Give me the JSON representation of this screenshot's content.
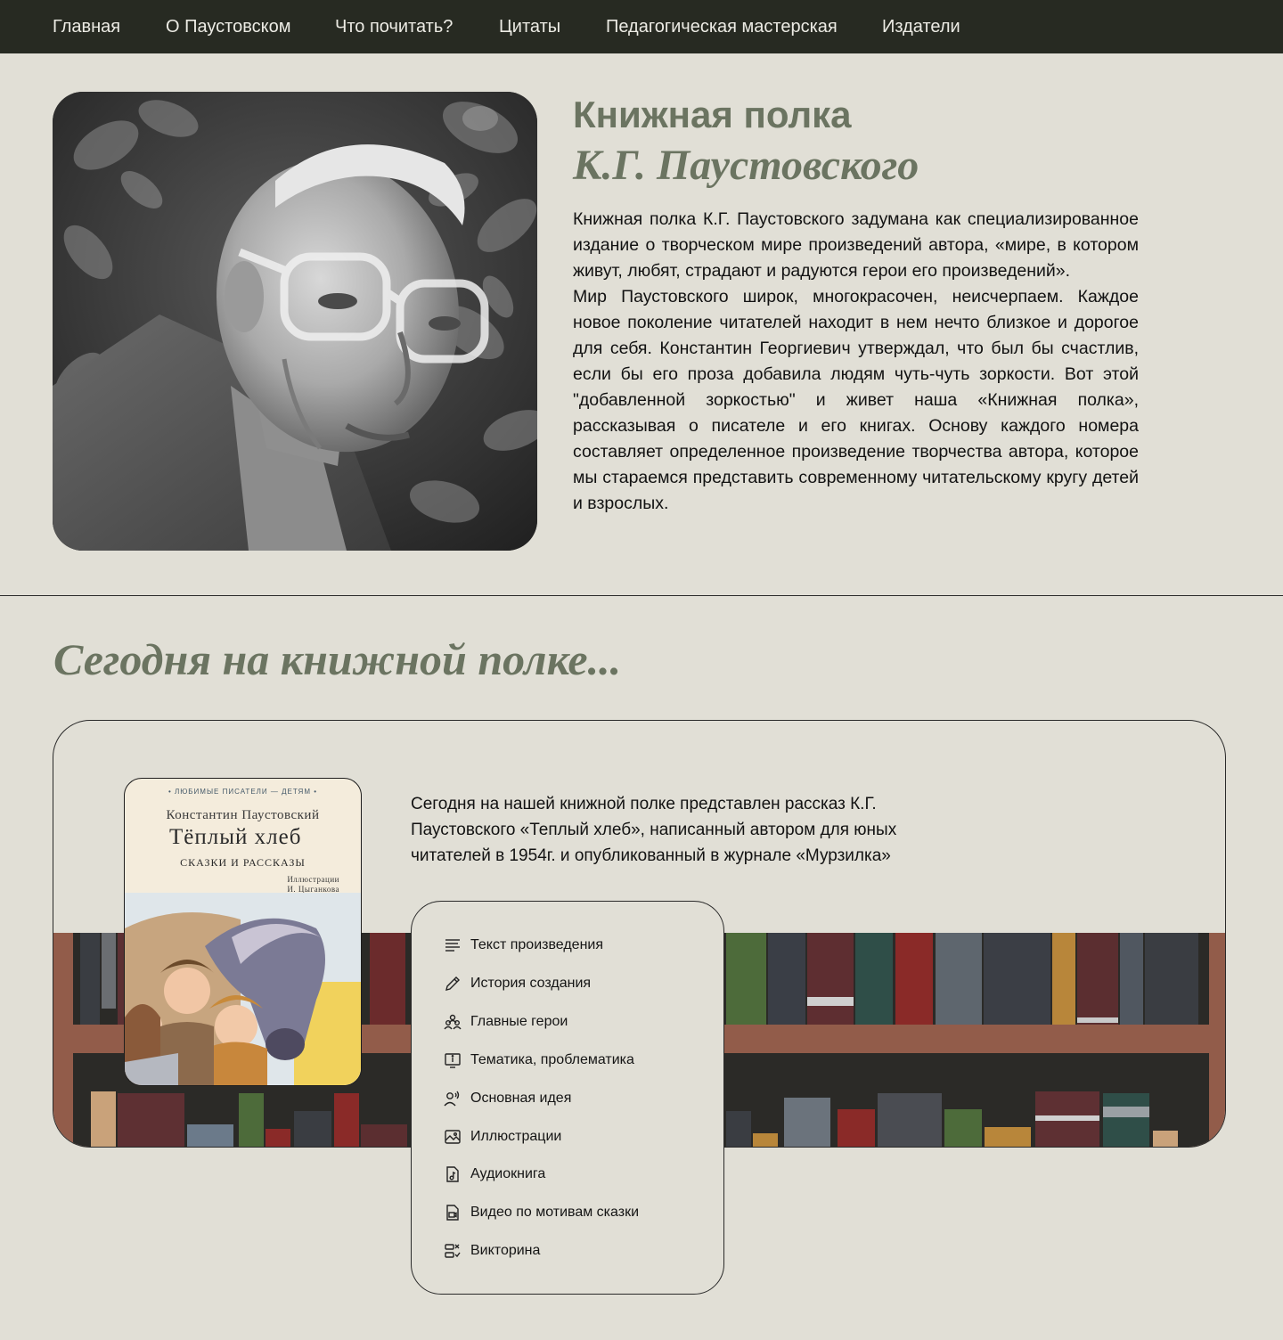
{
  "nav": {
    "items": [
      {
        "label": "Главная"
      },
      {
        "label": "О Паустовском"
      },
      {
        "label": "Что почитать?"
      },
      {
        "label": "Цитаты"
      },
      {
        "label": "Педагогическая мастерская"
      },
      {
        "label": "Издатели"
      }
    ]
  },
  "hero": {
    "title_line1": "Книжная полка",
    "title_line2": "К.Г. Паустовского",
    "paragraph1": "Книжная полка К.Г. Паустовского задумана как специализированное издание о творческом мире произведений автора, «мире, в котором живут, любят, страдают и радуются герои его произведений».",
    "paragraph2": "Мир Паустовского широк, многокрасочен, неисчерпаем. Каждое новое поколение читателей находит в нем нечто близкое и дорогое для себя. Константин Георгиевич утверждал, что был бы счастлив, если бы его проза добавила людям чуть-чуть зоркости. Вот этой \"добавленной зоркостью\" и живет наша «Книжная полка», рассказывая о писателе и его книгах. Основу каждого номера составляет определенное произведение творчества автора, которое мы стараемся представить современному читательскому кругу детей и взрослых."
  },
  "today": {
    "section_title": "Сегодня на книжной полке...",
    "description": "Сегодня на нашей книжной полке представлен рассказ К.Г. Паустовского «Теплый хлеб», написанный автором для юных читателей в 1954г. и опубликованный в журнале «Мурзилка»",
    "book_cover": {
      "series": "• ЛЮБИМЫЕ ПИСАТЕЛИ — ДЕТЯМ •",
      "author": "Константин Паустовский",
      "title": "Тёплый хлеб",
      "subtitle": "СКАЗКИ И РАССКАЗЫ",
      "illus_line1": "Иллюстрации",
      "illus_line2": "И. Цыганкова"
    },
    "menu": [
      {
        "label": "Текст произведения",
        "icon": "text-lines-icon"
      },
      {
        "label": "История создания",
        "icon": "pencil-icon"
      },
      {
        "label": "Главные герои",
        "icon": "people-icon"
      },
      {
        "label": "Тематика, проблематика",
        "icon": "info-board-icon"
      },
      {
        "label": "Основная идея",
        "icon": "speaking-person-icon"
      },
      {
        "label": "Иллюстрации",
        "icon": "image-icon"
      },
      {
        "label": "Аудиокнига",
        "icon": "audio-file-icon"
      },
      {
        "label": "Видео по мотивам сказки",
        "icon": "video-file-icon"
      },
      {
        "label": "Викторина",
        "icon": "quiz-icon"
      }
    ]
  },
  "colors": {
    "nav_bg": "#272a22",
    "page_bg": "#e1dfd6",
    "accent": "#6b7461",
    "shelf_wood": "#925c4a",
    "shelf_dark": "#2b2a27"
  }
}
